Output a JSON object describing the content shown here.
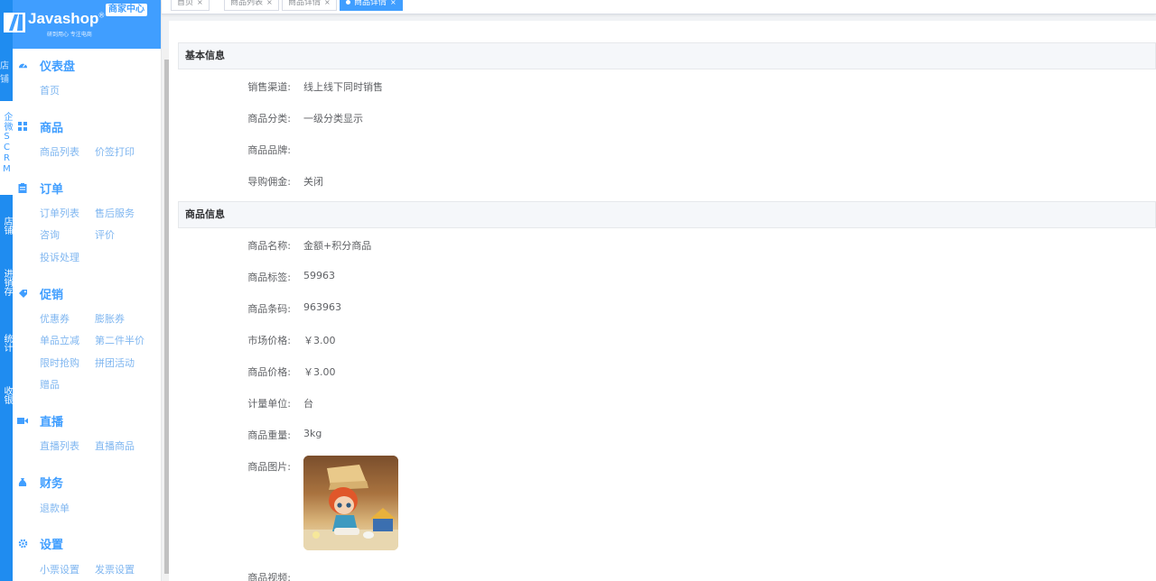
{
  "rail": {
    "items": [
      {
        "text": "店铺",
        "active": false
      },
      {
        "text": "企微SCRM",
        "active": true
      },
      {
        "text": "店铺",
        "active": false
      },
      {
        "text": "进销存",
        "active": false
      },
      {
        "text": "统计",
        "active": false
      },
      {
        "text": "收银",
        "active": false
      }
    ]
  },
  "brand": {
    "name": "Javashop",
    "reg": "®",
    "tagline": "研到用心 专注电商",
    "badge": "商家中心"
  },
  "menu": {
    "dashboard": {
      "title": "仪表盘",
      "links": [
        "首页"
      ]
    },
    "goods": {
      "title": "商品",
      "links": [
        "商品列表",
        "价签打印"
      ]
    },
    "orders": {
      "title": "订单",
      "links": [
        "订单列表",
        "售后服务",
        "咨询",
        "评价",
        "投诉处理"
      ]
    },
    "promo": {
      "title": "促销",
      "links": [
        "优惠券",
        "膨胀券",
        "单品立减",
        "第二件半价",
        "限时抢购",
        "拼团活动",
        "赠品"
      ]
    },
    "live": {
      "title": "直播",
      "links": [
        "直播列表",
        "直播商品"
      ]
    },
    "finance": {
      "title": "财务",
      "links": [
        "退款单"
      ]
    },
    "settings": {
      "title": "设置",
      "links": [
        "小票设置",
        "发票设置"
      ]
    }
  },
  "tabs": [
    {
      "label": "首页",
      "active": false
    },
    {
      "label": "商品列表",
      "active": false
    },
    {
      "label": "商品详情",
      "active": false
    },
    {
      "label": "商品详情",
      "active": true
    }
  ],
  "close_glyph": "×",
  "basic": {
    "header": "基本信息",
    "rows": [
      {
        "label": "销售渠道:",
        "value": "线上线下同时销售"
      },
      {
        "label": "商品分类:",
        "value": "一级分类显示"
      },
      {
        "label": "商品品牌:",
        "value": ""
      },
      {
        "label": "导购佣金:",
        "value": "关闭"
      }
    ]
  },
  "goods_info": {
    "header": "商品信息",
    "rows": [
      {
        "label": "商品名称:",
        "value": "金额+积分商品"
      },
      {
        "label": "商品标签:",
        "value": "59963"
      },
      {
        "label": "商品条码:",
        "value": "963963"
      },
      {
        "label": "市场价格:",
        "value": "￥3.00"
      },
      {
        "label": "商品价格:",
        "value": "￥3.00"
      },
      {
        "label": "计量单位:",
        "value": "台"
      },
      {
        "label": "商品重量:",
        "value": "3kg"
      },
      {
        "label": "商品图片:",
        "value": ""
      },
      {
        "label": "商品视频:",
        "value": ""
      }
    ]
  },
  "colors": {
    "primary": "#409eff",
    "rail": "#1f8cf0"
  }
}
